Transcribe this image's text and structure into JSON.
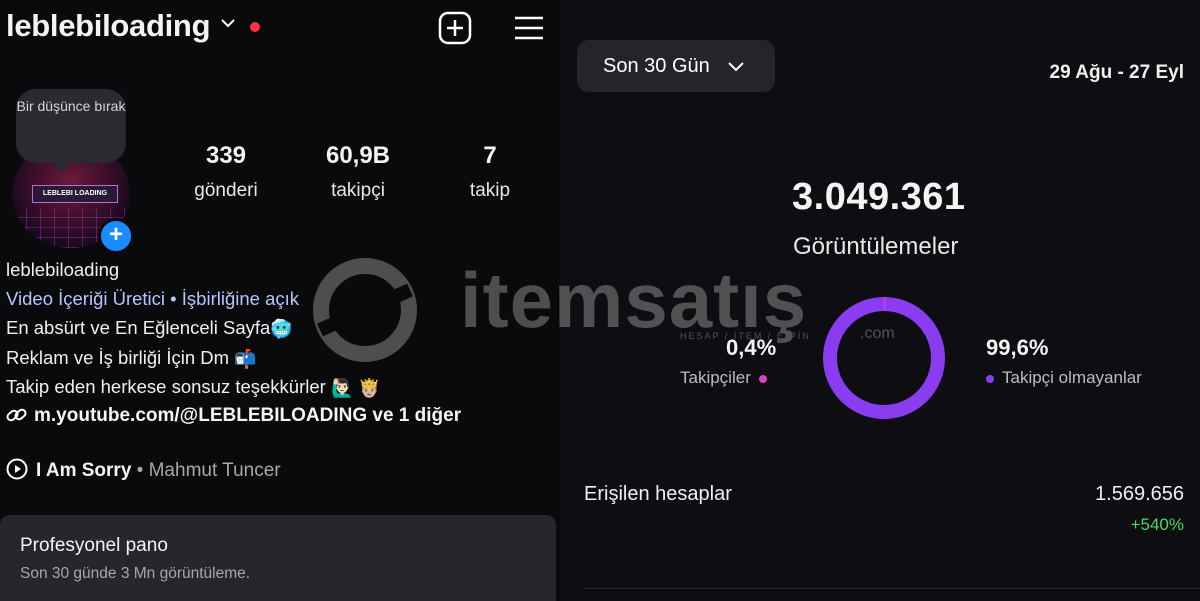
{
  "profile": {
    "username": "leblebiloading",
    "note": "Bir düşünce bırak",
    "stats": [
      {
        "value": "339",
        "label": "gönderi"
      },
      {
        "value": "60,9B",
        "label": "takipçi"
      },
      {
        "value": "7",
        "label": "takip"
      }
    ],
    "bio": {
      "name": "leblebiloading",
      "category": "Video İçeriği Üretici • İşbirliğine açık",
      "lines": [
        {
          "text": "En absürt ve En Eğlenceli Sayfa",
          "emoji": "🥶"
        },
        {
          "text": "Reklam ve İş birliği İçin Dm",
          "emoji": "📬"
        },
        {
          "text": "Takip eden herkese sonsuz teşekkürler ",
          "emoji": "🙋🏻‍♂️ 🤴🏼"
        }
      ],
      "link": "m.youtube.com/@LEBLEBILOADING ve 1 diğer",
      "music": {
        "song": "I Am Sorry",
        "separator": " • ",
        "artist": "Mahmut Tuncer"
      }
    },
    "avatar_banner": "LEBLEBI LOADING",
    "pro_panel": {
      "title": "Profesyonel pano",
      "subtitle": "Son 30 günde 3 Mn görüntüleme."
    }
  },
  "insights": {
    "period": "Son 30 Gün",
    "date_range": "29 Ağu - 27 Eyl",
    "views_value": "3.049.361",
    "views_label": "Görüntülemeler",
    "followers_pct": "0,4%",
    "followers_label": "Takipçiler",
    "non_followers_pct": "99,6%",
    "non_followers_label": "Takipçi olmayanlar",
    "followers_fraction": 0.004,
    "reach_label": "Erişilen hesaplar",
    "reach_value": "1.569.656",
    "reach_delta": "+540%"
  },
  "watermark": {
    "text": "itemsatış",
    "sub": "HESAP / İTEM / E-PİN",
    "suffix": ".com"
  },
  "colors": {
    "accent_purple": "#8a3cf0",
    "pink": "#e040c0",
    "positive": "#4cd964",
    "live": "#ff3040",
    "story_blue": "#1a8cff"
  }
}
